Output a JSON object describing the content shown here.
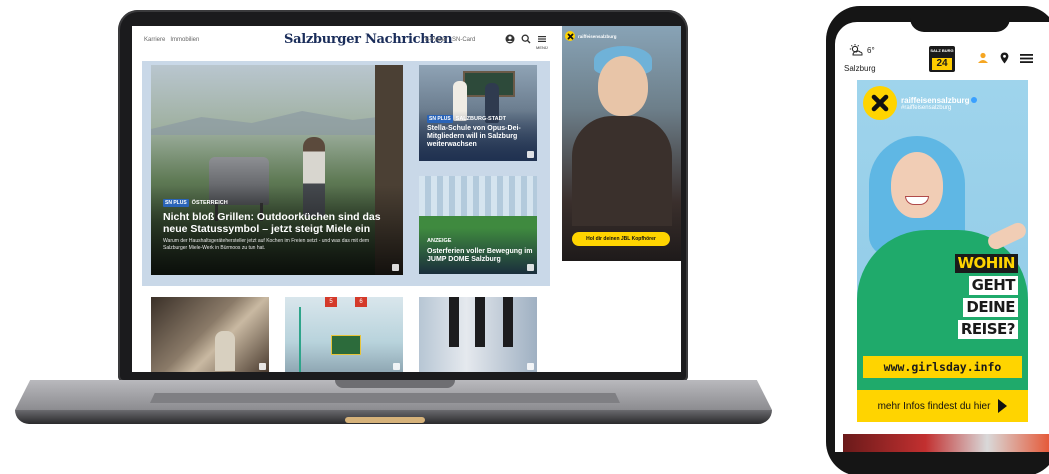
{
  "laptop": {
    "site": {
      "top_links": [
        "Karriere",
        "Immobilien"
      ],
      "logo": "Salzburger Nachrichten",
      "right_links": [
        "E-Paper",
        "SN-Card"
      ],
      "menu_label": "MENÜ",
      "icons": [
        "user-icon",
        "search-icon",
        "menu-icon"
      ]
    },
    "main_story": {
      "badge": "SN PLUS",
      "category": "ÖSTERREICH",
      "title": "Nicht bloß Grillen: Outdoorküchen sind das neue Statussymbol – jetzt steigt Miele ein",
      "teaser": "Warum der Haushaltsgerätehersteller jetzt auf Kochen im Freien setzt - und was das mit dem Salzburger Miele-Werk in Bürmoos zu tun hat."
    },
    "side_stories": [
      {
        "badge": "SN PLUS",
        "category": "SALZBURG-STADT",
        "title": "Stella-Schule von Opus-Dei-Mitgliedern will in Salzburg weiterwachsen"
      },
      {
        "badge": "",
        "category": "ANZEIGE",
        "title": "Osterferien voller Bewegung im JUMP DOME Salzburg"
      }
    ],
    "bottom_row": {
      "sign_numbers": [
        "5",
        "6"
      ]
    },
    "ad": {
      "brand": "raiffeisensalzburg",
      "cta": "Hol dir deinen JBL Kopfhörer"
    }
  },
  "phone": {
    "weather": {
      "temp": "6°",
      "city": "Salzburg"
    },
    "logo": {
      "top": "SALZ BURG",
      "number": "24"
    },
    "ad": {
      "brand": "raiffeisensalzburg",
      "hashtag": "#raiffeisensalzburg",
      "headline": [
        "WOHIN",
        "GEHT",
        "DEINE",
        "REISE?"
      ],
      "url": "www.girlsday.info",
      "more": "mehr Infos findest du hier"
    }
  },
  "colors": {
    "sn_blue": "#1a2d5a",
    "plus_badge": "#2a64b8",
    "raiffeisen_yellow": "#ffd400",
    "featured_bg": "#c9d8e8"
  }
}
